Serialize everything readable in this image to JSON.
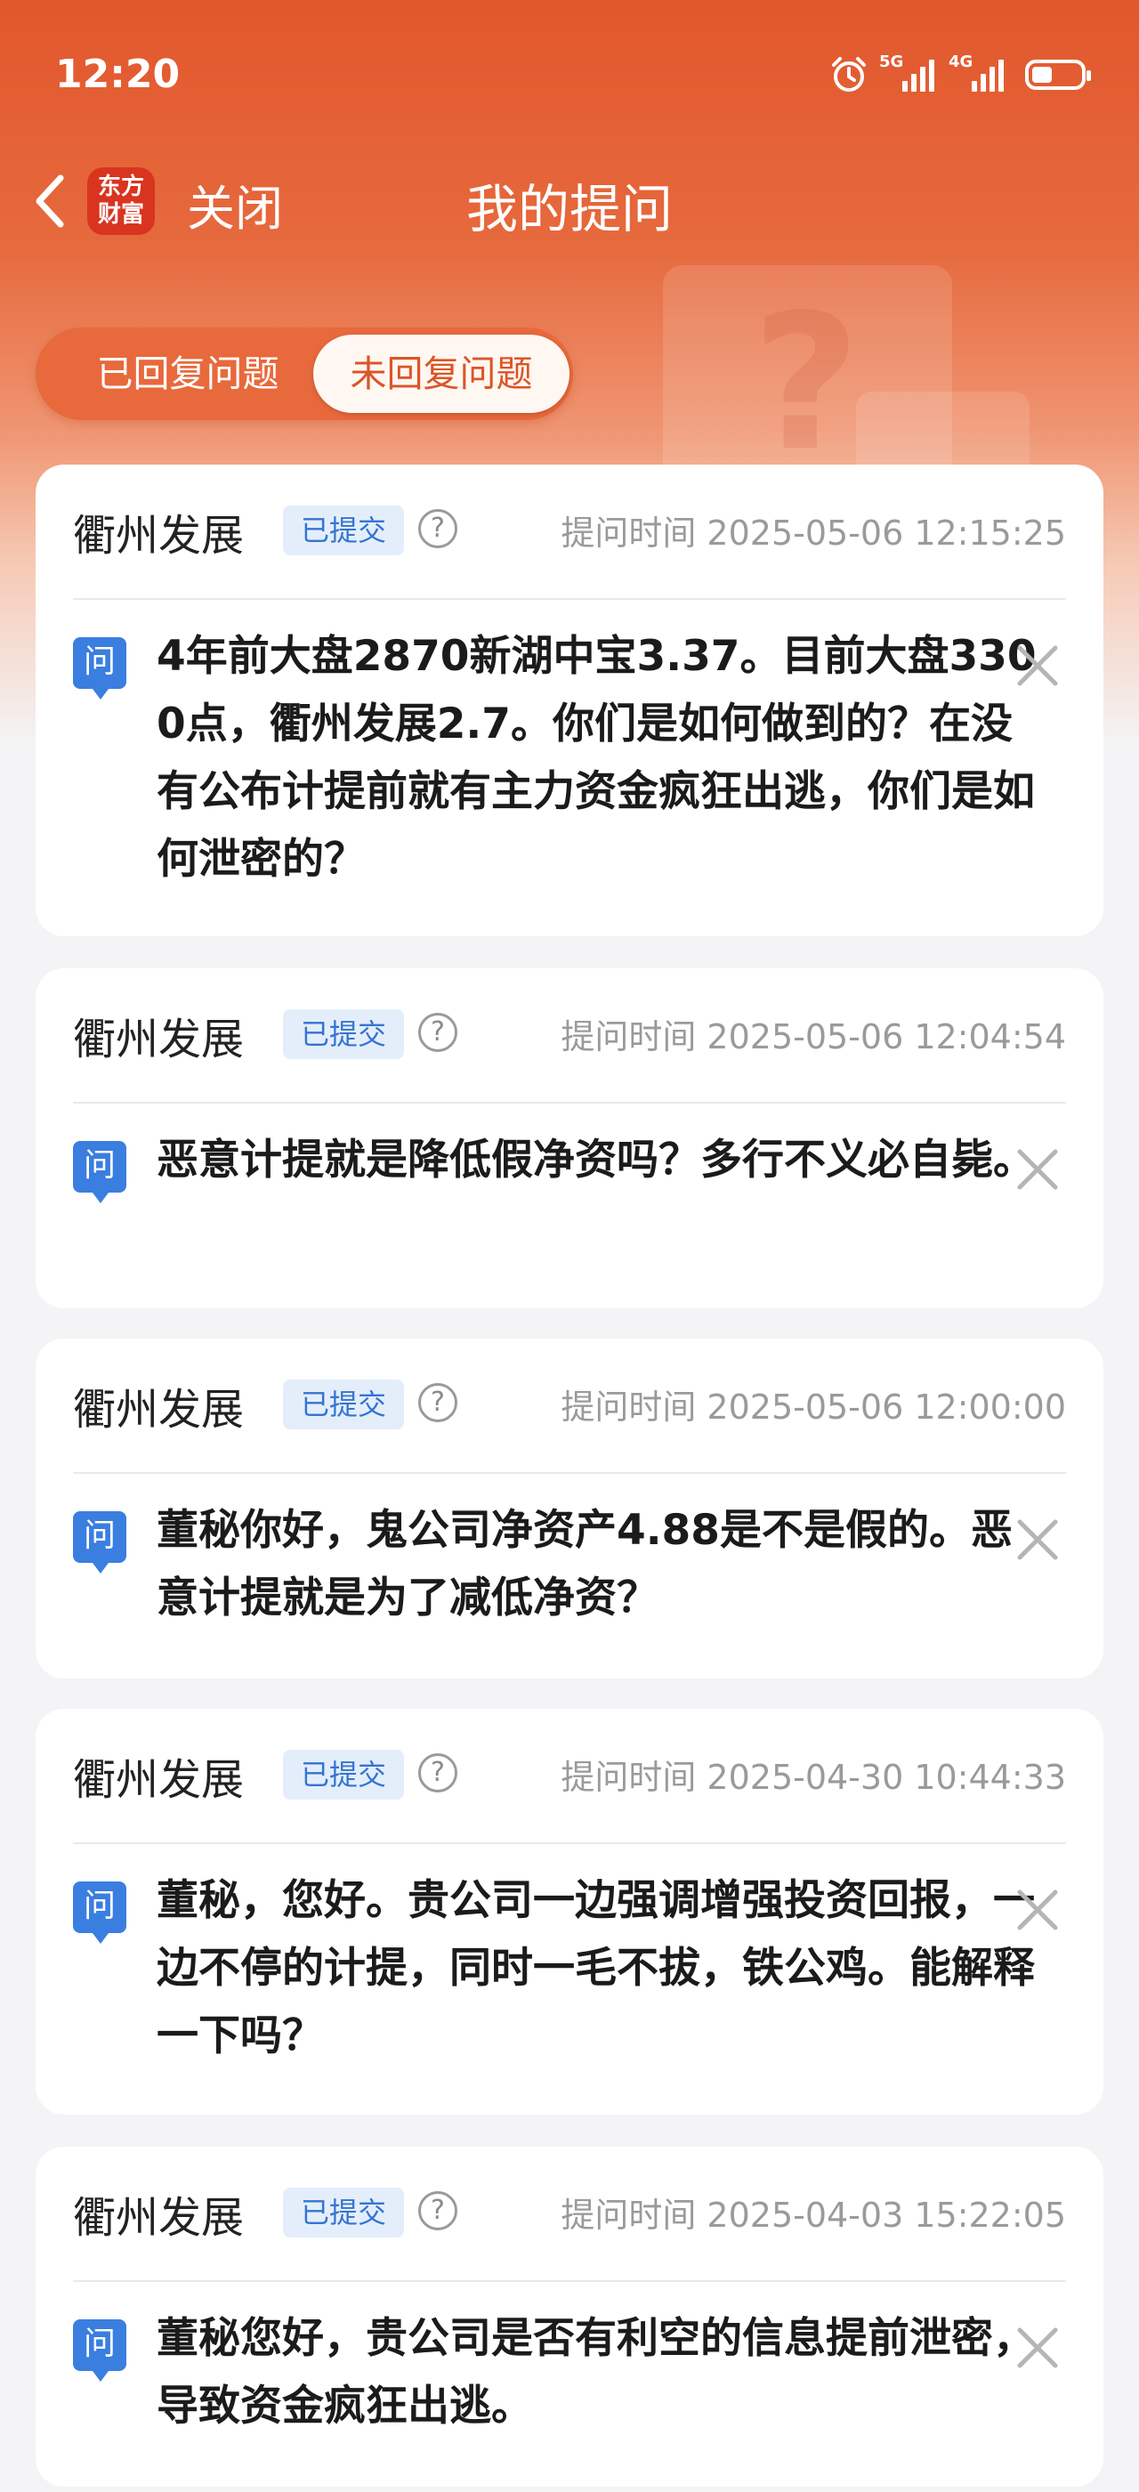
{
  "status_bar": {
    "time": "12:20",
    "signal_1_label": "5G",
    "signal_2_label": "4G"
  },
  "nav": {
    "logo_line1": "东方",
    "logo_line2": "财富",
    "close_label": "关闭",
    "title": "我的提问"
  },
  "tabs": [
    {
      "label": "已回复问题",
      "active": false
    },
    {
      "label": "未回复问题",
      "active": true
    }
  ],
  "questions": [
    {
      "company": "衢州发展",
      "status": "已提交",
      "time": "提问时间 2025-05-06 12:15:25",
      "icon_label": "问",
      "text": "4年前大盘2870新湖中宝3.37。目前大盘3300点，衢州发展2.7。你们是如何做到的？在没有公布计提前就有主力资金疯狂出逃，你们是如何泄密的？"
    },
    {
      "company": "衢州发展",
      "status": "已提交",
      "time": "提问时间 2025-05-06 12:04:54",
      "icon_label": "问",
      "text": "恶意计提就是降低假净资吗？多行不义必自毙。"
    },
    {
      "company": "衢州发展",
      "status": "已提交",
      "time": "提问时间 2025-05-06 12:00:00",
      "icon_label": "问",
      "text": "董秘你好，鬼公司净资产4.88是不是假的。恶意计提就是为了减低净资？"
    },
    {
      "company": "衢州发展",
      "status": "已提交",
      "time": "提问时间 2025-04-30 10:44:33",
      "icon_label": "问",
      "text": "董秘，您好。贵公司一边强调增强投资回报，一边不停的计提，同时一毛不拔，铁公鸡。能解释一下吗？"
    },
    {
      "company": "衢州发展",
      "status": "已提交",
      "time": "提问时间 2025-04-03 15:22:05",
      "icon_label": "问",
      "text": "董秘您好，贵公司是否有利空的信息提前泄密，导致资金疯狂出逃。"
    }
  ],
  "colors": {
    "header_orange": "#e2572c",
    "active_tab_text": "#dc5526",
    "badge_blue": "#3574d2",
    "question_icon_blue": "#3a7ee0"
  }
}
